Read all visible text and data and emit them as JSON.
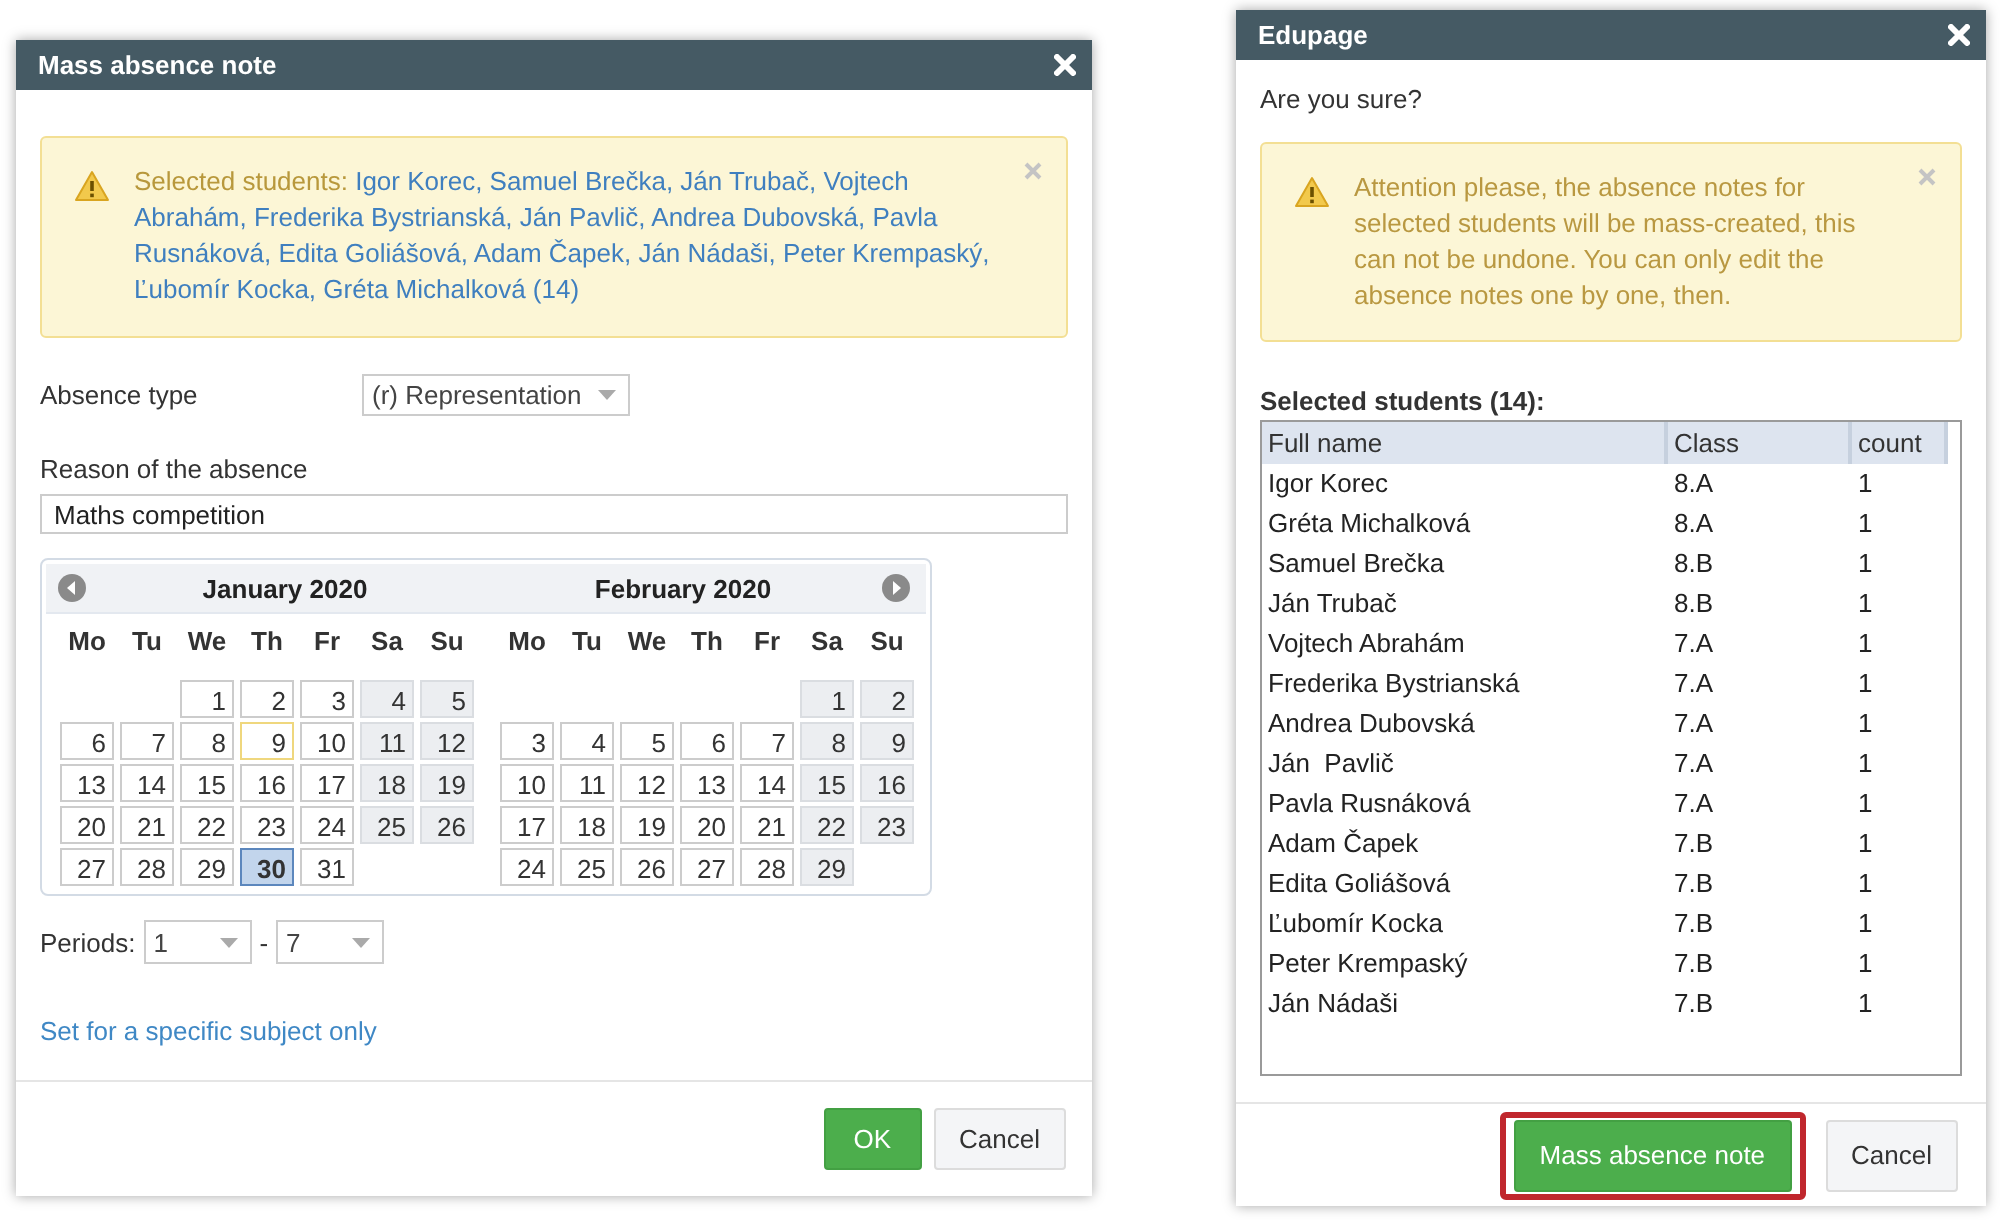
{
  "mass_note": {
    "title": "Mass absence note",
    "alert": {
      "label": "Selected students:",
      "students": "Igor Korec, Samuel Brečka, Ján Trubač, Vojtech Abrahám, Frederika Bystrianská, Ján Pavlič, Andrea Dubovská, Pavla Rusnáková, Edita Goliášová, Adam Čapek, Ján Nádaši, Peter Krempaský, Ľubomír Kocka, Gréta Michalková (14)"
    },
    "absence_type": {
      "label": "Absence type",
      "value": "(r) Representation"
    },
    "reason": {
      "label": "Reason of the absence",
      "value": "Maths competition"
    },
    "calendar": {
      "months": [
        {
          "title": "January 2020",
          "weekdays": [
            "Mo",
            "Tu",
            "We",
            "Th",
            "Fr",
            "Sa",
            "Su"
          ],
          "weeks": [
            [
              {
                "day": "1",
                "weekend": false,
                "today": false,
                "selected": false
              },
              {
                "day": "2",
                "weekend": false,
                "today": false,
                "selected": false
              },
              {
                "day": "3",
                "weekend": false,
                "today": false,
                "selected": false
              },
              {
                "day": "4",
                "weekend": true,
                "today": false,
                "selected": false
              },
              {
                "day": "5",
                "weekend": true,
                "today": false,
                "selected": false
              }
            ],
            [
              {
                "day": "6",
                "weekend": false,
                "today": false,
                "selected": false
              },
              {
                "day": "7",
                "weekend": false,
                "today": false,
                "selected": false
              },
              {
                "day": "8",
                "weekend": false,
                "today": false,
                "selected": false
              },
              {
                "day": "9",
                "weekend": false,
                "today": true,
                "selected": false
              },
              {
                "day": "10",
                "weekend": false,
                "today": false,
                "selected": false
              },
              {
                "day": "11",
                "weekend": true,
                "today": false,
                "selected": false
              },
              {
                "day": "12",
                "weekend": true,
                "today": false,
                "selected": false
              }
            ],
            [
              {
                "day": "13",
                "weekend": false,
                "today": false,
                "selected": false
              },
              {
                "day": "14",
                "weekend": false,
                "today": false,
                "selected": false
              },
              {
                "day": "15",
                "weekend": false,
                "today": false,
                "selected": false
              },
              {
                "day": "16",
                "weekend": false,
                "today": false,
                "selected": false
              },
              {
                "day": "17",
                "weekend": false,
                "today": false,
                "selected": false
              },
              {
                "day": "18",
                "weekend": true,
                "today": false,
                "selected": false
              },
              {
                "day": "19",
                "weekend": true,
                "today": false,
                "selected": false
              }
            ],
            [
              {
                "day": "20",
                "weekend": false,
                "today": false,
                "selected": false
              },
              {
                "day": "21",
                "weekend": false,
                "today": false,
                "selected": false
              },
              {
                "day": "22",
                "weekend": false,
                "today": false,
                "selected": false
              },
              {
                "day": "23",
                "weekend": false,
                "today": false,
                "selected": false
              },
              {
                "day": "24",
                "weekend": false,
                "today": false,
                "selected": false
              },
              {
                "day": "25",
                "weekend": true,
                "today": false,
                "selected": false
              },
              {
                "day": "26",
                "weekend": true,
                "today": false,
                "selected": false
              }
            ],
            [
              {
                "day": "27",
                "weekend": false,
                "today": false,
                "selected": false
              },
              {
                "day": "28",
                "weekend": false,
                "today": false,
                "selected": false
              },
              {
                "day": "29",
                "weekend": false,
                "today": false,
                "selected": false
              },
              {
                "day": "30",
                "weekend": false,
                "today": false,
                "selected": true
              },
              {
                "day": "31",
                "weekend": false,
                "today": false,
                "selected": false
              }
            ]
          ]
        },
        {
          "title": "February 2020",
          "weekdays": [
            "Mo",
            "Tu",
            "We",
            "Th",
            "Fr",
            "Sa",
            "Su"
          ],
          "weeks": [
            [
              {
                "day": "1",
                "weekend": true,
                "today": false,
                "selected": false
              },
              {
                "day": "2",
                "weekend": true,
                "today": false,
                "selected": false
              }
            ],
            [
              {
                "day": "3",
                "weekend": false,
                "today": false,
                "selected": false
              },
              {
                "day": "4",
                "weekend": false,
                "today": false,
                "selected": false
              },
              {
                "day": "5",
                "weekend": false,
                "today": false,
                "selected": false
              },
              {
                "day": "6",
                "weekend": false,
                "today": false,
                "selected": false
              },
              {
                "day": "7",
                "weekend": false,
                "today": false,
                "selected": false
              },
              {
                "day": "8",
                "weekend": true,
                "today": false,
                "selected": false
              },
              {
                "day": "9",
                "weekend": true,
                "today": false,
                "selected": false
              }
            ],
            [
              {
                "day": "10",
                "weekend": false,
                "today": false,
                "selected": false
              },
              {
                "day": "11",
                "weekend": false,
                "today": false,
                "selected": false
              },
              {
                "day": "12",
                "weekend": false,
                "today": false,
                "selected": false
              },
              {
                "day": "13",
                "weekend": false,
                "today": false,
                "selected": false
              },
              {
                "day": "14",
                "weekend": false,
                "today": false,
                "selected": false
              },
              {
                "day": "15",
                "weekend": true,
                "today": false,
                "selected": false
              },
              {
                "day": "16",
                "weekend": true,
                "today": false,
                "selected": false
              }
            ],
            [
              {
                "day": "17",
                "weekend": false,
                "today": false,
                "selected": false
              },
              {
                "day": "18",
                "weekend": false,
                "today": false,
                "selected": false
              },
              {
                "day": "19",
                "weekend": false,
                "today": false,
                "selected": false
              },
              {
                "day": "20",
                "weekend": false,
                "today": false,
                "selected": false
              },
              {
                "day": "21",
                "weekend": false,
                "today": false,
                "selected": false
              },
              {
                "day": "22",
                "weekend": true,
                "today": false,
                "selected": false
              },
              {
                "day": "23",
                "weekend": true,
                "today": false,
                "selected": false
              }
            ],
            [
              {
                "day": "24",
                "weekend": false,
                "today": false,
                "selected": false
              },
              {
                "day": "25",
                "weekend": false,
                "today": false,
                "selected": false
              },
              {
                "day": "26",
                "weekend": false,
                "today": false,
                "selected": false
              },
              {
                "day": "27",
                "weekend": false,
                "today": false,
                "selected": false
              },
              {
                "day": "28",
                "weekend": false,
                "today": false,
                "selected": false
              },
              {
                "day": "29",
                "weekend": true,
                "today": false,
                "selected": false
              }
            ]
          ]
        }
      ]
    },
    "periods": {
      "label": "Periods:",
      "from": "1",
      "separator": "-",
      "to": "7"
    },
    "subject_link": "Set for a specific subject only",
    "buttons": [
      {
        "label": "OK",
        "kind": "primary",
        "highlighted": false
      },
      {
        "label": "Cancel",
        "kind": "default",
        "highlighted": false
      }
    ]
  },
  "confirm": {
    "title": "Edupage",
    "question": "Are you sure?",
    "alert": "Attention please, the absence notes for selected students will be mass-created, this can not be undone. You can only edit the absence notes one by one, then.",
    "table_title": "Selected students (14):",
    "table": {
      "columns": [
        "Full name",
        "Class",
        "count"
      ],
      "rows": [
        [
          "Igor Korec",
          "8.A",
          "1"
        ],
        [
          "Gréta Michalková",
          "8.A",
          "1"
        ],
        [
          "Samuel Brečka",
          "8.B",
          "1"
        ],
        [
          "Ján Trubač",
          "8.B",
          "1"
        ],
        [
          "Vojtech Abrahám",
          "7.A",
          "1"
        ],
        [
          "Frederika Bystrianská",
          "7.A",
          "1"
        ],
        [
          "Andrea Dubovská",
          "7.A",
          "1"
        ],
        [
          "Ján  Pavlič",
          "7.A",
          "1"
        ],
        [
          "Pavla Rusnáková",
          "7.A",
          "1"
        ],
        [
          "Adam Čapek",
          "7.B",
          "1"
        ],
        [
          "Edita Goliášová",
          "7.B",
          "1"
        ],
        [
          "Ľubomír Kocka",
          "7.B",
          "1"
        ],
        [
          "Peter Krempaský",
          "7.B",
          "1"
        ],
        [
          "Ján Nádaši",
          "7.B",
          "1"
        ]
      ]
    },
    "buttons": [
      {
        "label": "Mass absence note",
        "kind": "primary",
        "highlighted": true
      },
      {
        "label": "Cancel",
        "kind": "default",
        "highlighted": false
      }
    ]
  }
}
